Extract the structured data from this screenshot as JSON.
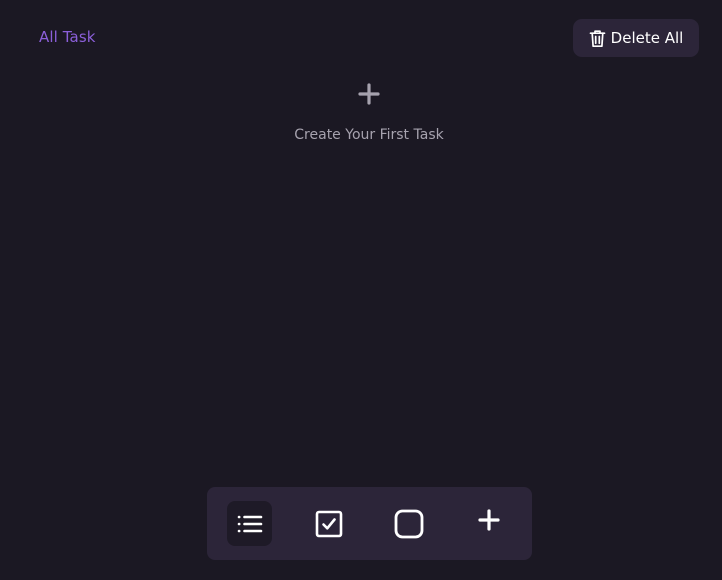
{
  "header": {
    "title": "All Task",
    "delete_all_label": "Delete All",
    "delete_icon": "trash-icon"
  },
  "empty_state": {
    "icon": "plus-icon",
    "message": "Create Your First Task"
  },
  "bottom_nav": {
    "items": [
      {
        "name": "all-tasks",
        "icon": "list-icon",
        "active": true
      },
      {
        "name": "completed-tasks",
        "icon": "checkbox-checked-icon",
        "active": false
      },
      {
        "name": "pending-tasks",
        "icon": "checkbox-empty-icon",
        "active": false
      },
      {
        "name": "add-task",
        "icon": "plus-icon",
        "active": false
      }
    ]
  },
  "colors": {
    "background": "#1b1823",
    "surface": "#2c2539",
    "accent": "#8b5fd9",
    "muted_text": "#a6a2ae",
    "text": "#ffffff"
  }
}
